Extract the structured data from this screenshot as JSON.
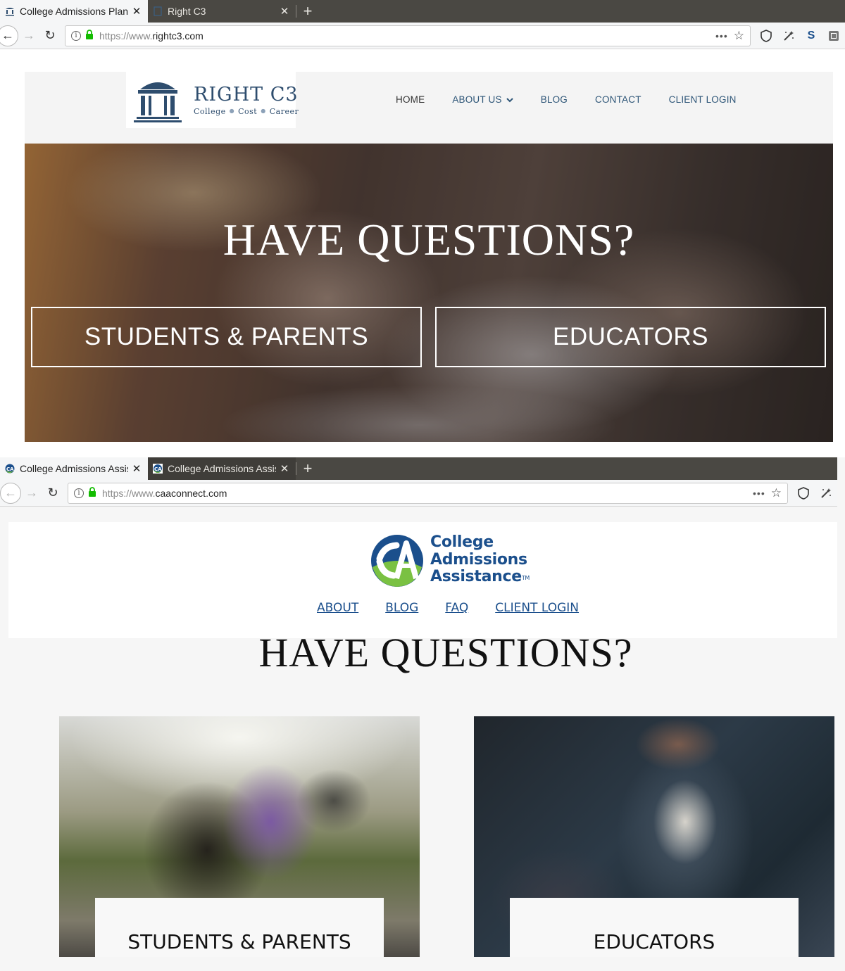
{
  "window1": {
    "tabs": [
      {
        "title": "College Admissions Plann",
        "active": true,
        "icon": "right-c3-building-icon"
      },
      {
        "title": "Right C3",
        "active": false,
        "icon": "blank-page-icon"
      }
    ],
    "url": {
      "protocol": "https://www.",
      "host": "rightc3.com"
    },
    "toolbar_icons": [
      "page-actions-icon",
      "bookmark-star-icon",
      "shield-icon",
      "wand-icon",
      "s-extension-icon",
      "sidebar-icon"
    ],
    "page": {
      "logo": {
        "name": "RIGHT C3",
        "tagline": [
          "College",
          "Cost",
          "Career"
        ]
      },
      "nav": [
        "HOME",
        "ABOUT US",
        "BLOG",
        "CONTACT",
        "CLIENT LOGIN"
      ],
      "hero": {
        "heading": "HAVE QUESTIONS?",
        "buttons": [
          "STUDENTS & PARENTS",
          "EDUCATORS"
        ]
      }
    }
  },
  "window2": {
    "tabs": [
      {
        "title": "College Admissions Assis",
        "active": true,
        "icon": "caa-globe-icon"
      },
      {
        "title": "College Admissions Assis",
        "active": false,
        "icon": "caa-globe-icon"
      }
    ],
    "url": {
      "protocol": "https://www.",
      "host": "caaconnect.com"
    },
    "toolbar_icons": [
      "page-actions-icon",
      "bookmark-star-icon",
      "shield-icon",
      "wand-icon"
    ],
    "page": {
      "logo": {
        "line1": "College",
        "line2": "Admissions",
        "line3": "Assistance",
        "tm": "TM"
      },
      "nav": [
        "ABOUT",
        "BLOG",
        "FAQ",
        "CLIENT LOGIN"
      ],
      "heading": "HAVE QUESTIONS?",
      "cards": [
        "STUDENTS & PARENTS",
        "EDUCATORS"
      ]
    }
  },
  "colors": {
    "tabbar_bg": "#4a4843",
    "rc3_brand": "#2e4d6e",
    "caa_brand": "#1b4f8c",
    "caa_green": "#7ac142"
  }
}
